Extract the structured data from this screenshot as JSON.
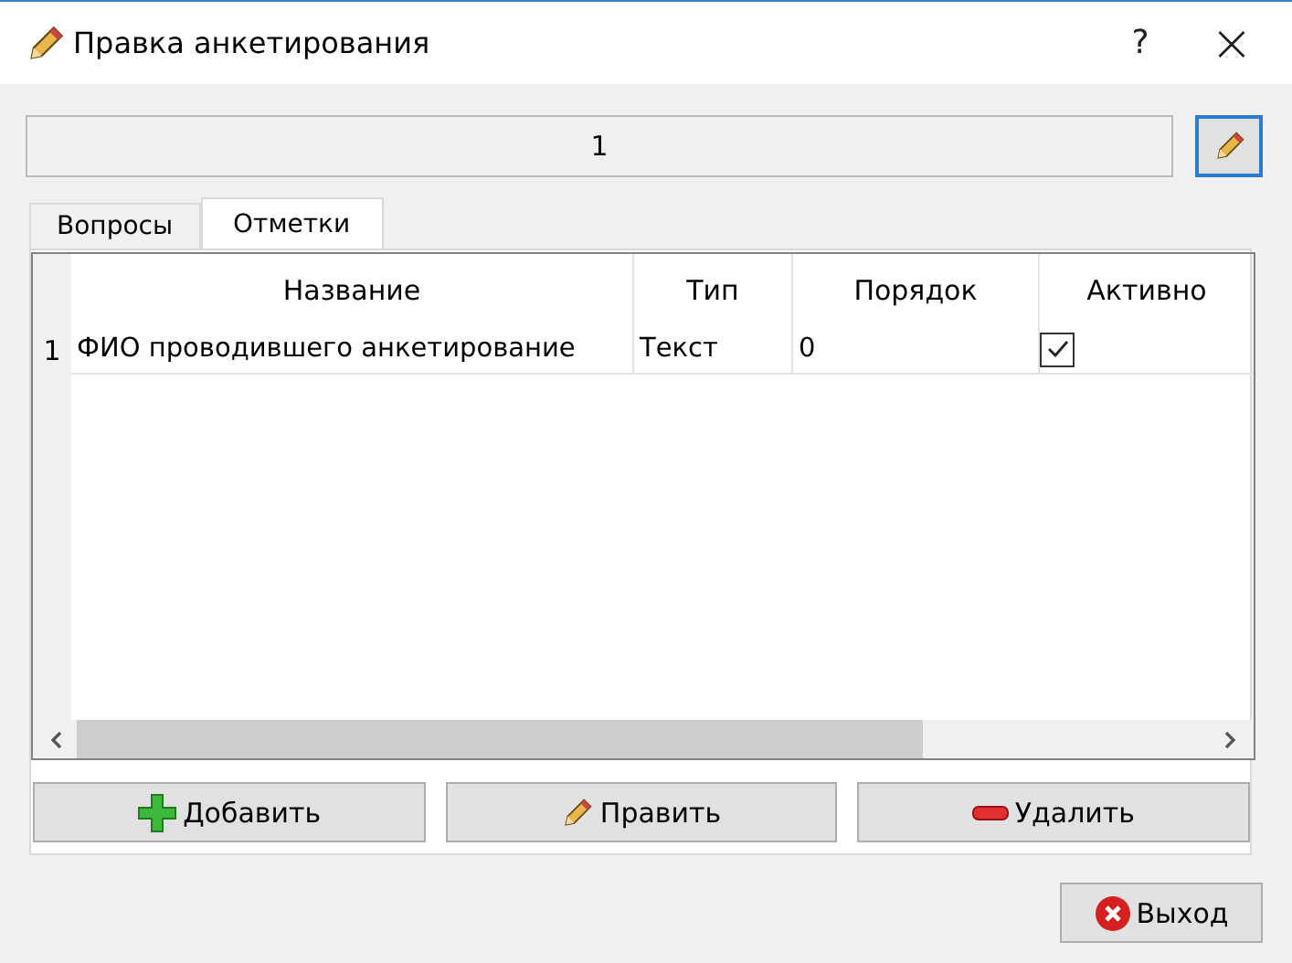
{
  "window": {
    "title": "Правка анкетирования",
    "help": "?",
    "close": "×"
  },
  "field": {
    "value": "1"
  },
  "tabs": [
    {
      "label": "Вопросы",
      "selected": false
    },
    {
      "label": "Отметки",
      "selected": true
    }
  ],
  "table": {
    "columns": [
      "Название",
      "Тип",
      "Порядок",
      "Активно"
    ],
    "rows": [
      {
        "number": "1",
        "name": "ФИО проводившего анкетирование",
        "type": "Текст",
        "order": "0",
        "active": true
      }
    ]
  },
  "actions": [
    {
      "kind": "add",
      "label": "Добавить"
    },
    {
      "kind": "edit",
      "label": "Править"
    },
    {
      "kind": "delete",
      "label": "Удалить"
    }
  ],
  "exit": {
    "label": "Выход"
  }
}
